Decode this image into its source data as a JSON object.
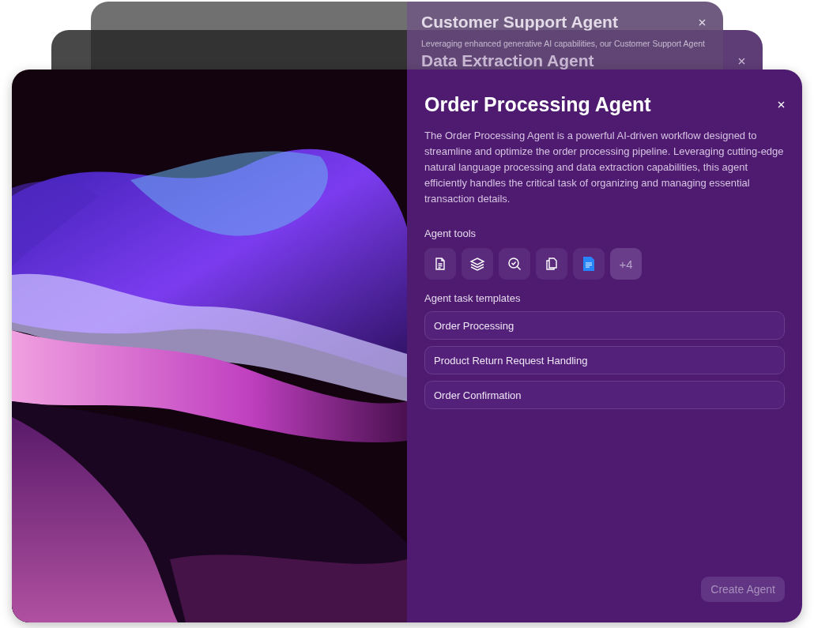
{
  "background_cards": [
    {
      "title": "Customer Support Agent",
      "description": "Leveraging enhanced generative AI capabilities, our Customer Support Agent"
    },
    {
      "title": "Data Extraction Agent"
    }
  ],
  "dialog": {
    "title": "Order Processing Agent",
    "description": "The Order Processing Agent is a powerful AI-driven workflow designed to streamline and optimize the order processing pipeline. Leveraging cutting-edge natural language processing and data extraction capabilities, this agent efficiently handles the critical task of organizing and managing essential transaction details.",
    "tools_label": "Agent tools",
    "tools_more": "+4",
    "templates_label": "Agent task templates",
    "templates": [
      "Order Processing",
      "Product Return Request Handling",
      "Order Confirmation"
    ],
    "create_button": {
      "label": "Create Agent",
      "disabled": true
    }
  }
}
